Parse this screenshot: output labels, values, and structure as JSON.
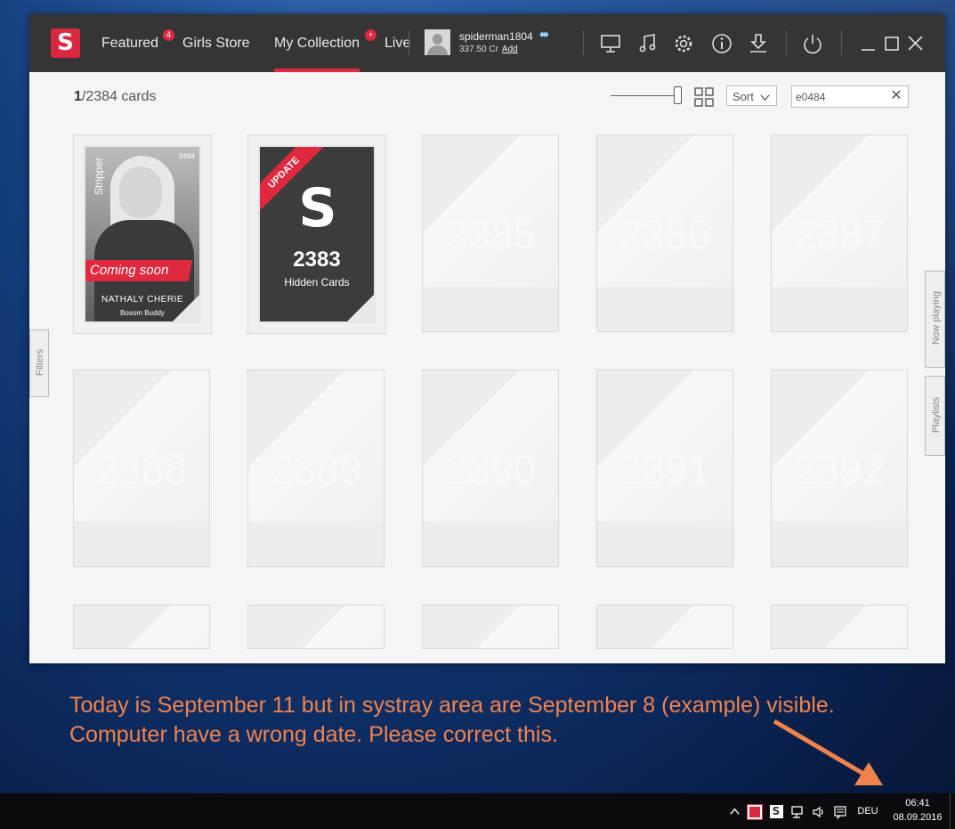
{
  "app": {
    "nav": {
      "featured": "Featured",
      "featured_badge": "4",
      "girls_store": "Girls Store",
      "my_collection": "My Collection",
      "my_collection_badge": "+",
      "live": "Live"
    },
    "user": {
      "username": "spiderman1804",
      "credits": "337.50 Cr",
      "add": "Add"
    },
    "toolbar_icons": [
      "monitor-icon",
      "music-icon",
      "gear-icon",
      "info-icon",
      "download-icon",
      "power-icon",
      "minimize-icon",
      "maximize-icon",
      "close-icon"
    ]
  },
  "collection": {
    "count_current": "1",
    "count_total": "/2384 cards",
    "sort_label": "Sort",
    "search_value": "e0484",
    "zoom_level": 1.0
  },
  "cards": {
    "featured_card": {
      "category": "Stripper",
      "number": "0484",
      "banner": "Coming soon",
      "name": "NATHALY CHERIE",
      "subtitle": "Bosom Buddy"
    },
    "hidden_card": {
      "ribbon": "UPDATE",
      "count": "2383",
      "label": "Hidden Cards"
    },
    "placeholders": [
      "2385",
      "2386",
      "2387",
      "2388",
      "2389",
      "2390",
      "2391",
      "2392"
    ]
  },
  "side_tabs": {
    "filters": "Filters",
    "now_playing": "Now playing",
    "playlists": "Playlists"
  },
  "annotation": {
    "line1": "Today is September 11 but in systray area are September 8 (example) visible.",
    "line2": "Computer have a wrong date. Please correct this."
  },
  "taskbar": {
    "language": "DEU",
    "time": "06:41",
    "date": "08.09.2016"
  }
}
